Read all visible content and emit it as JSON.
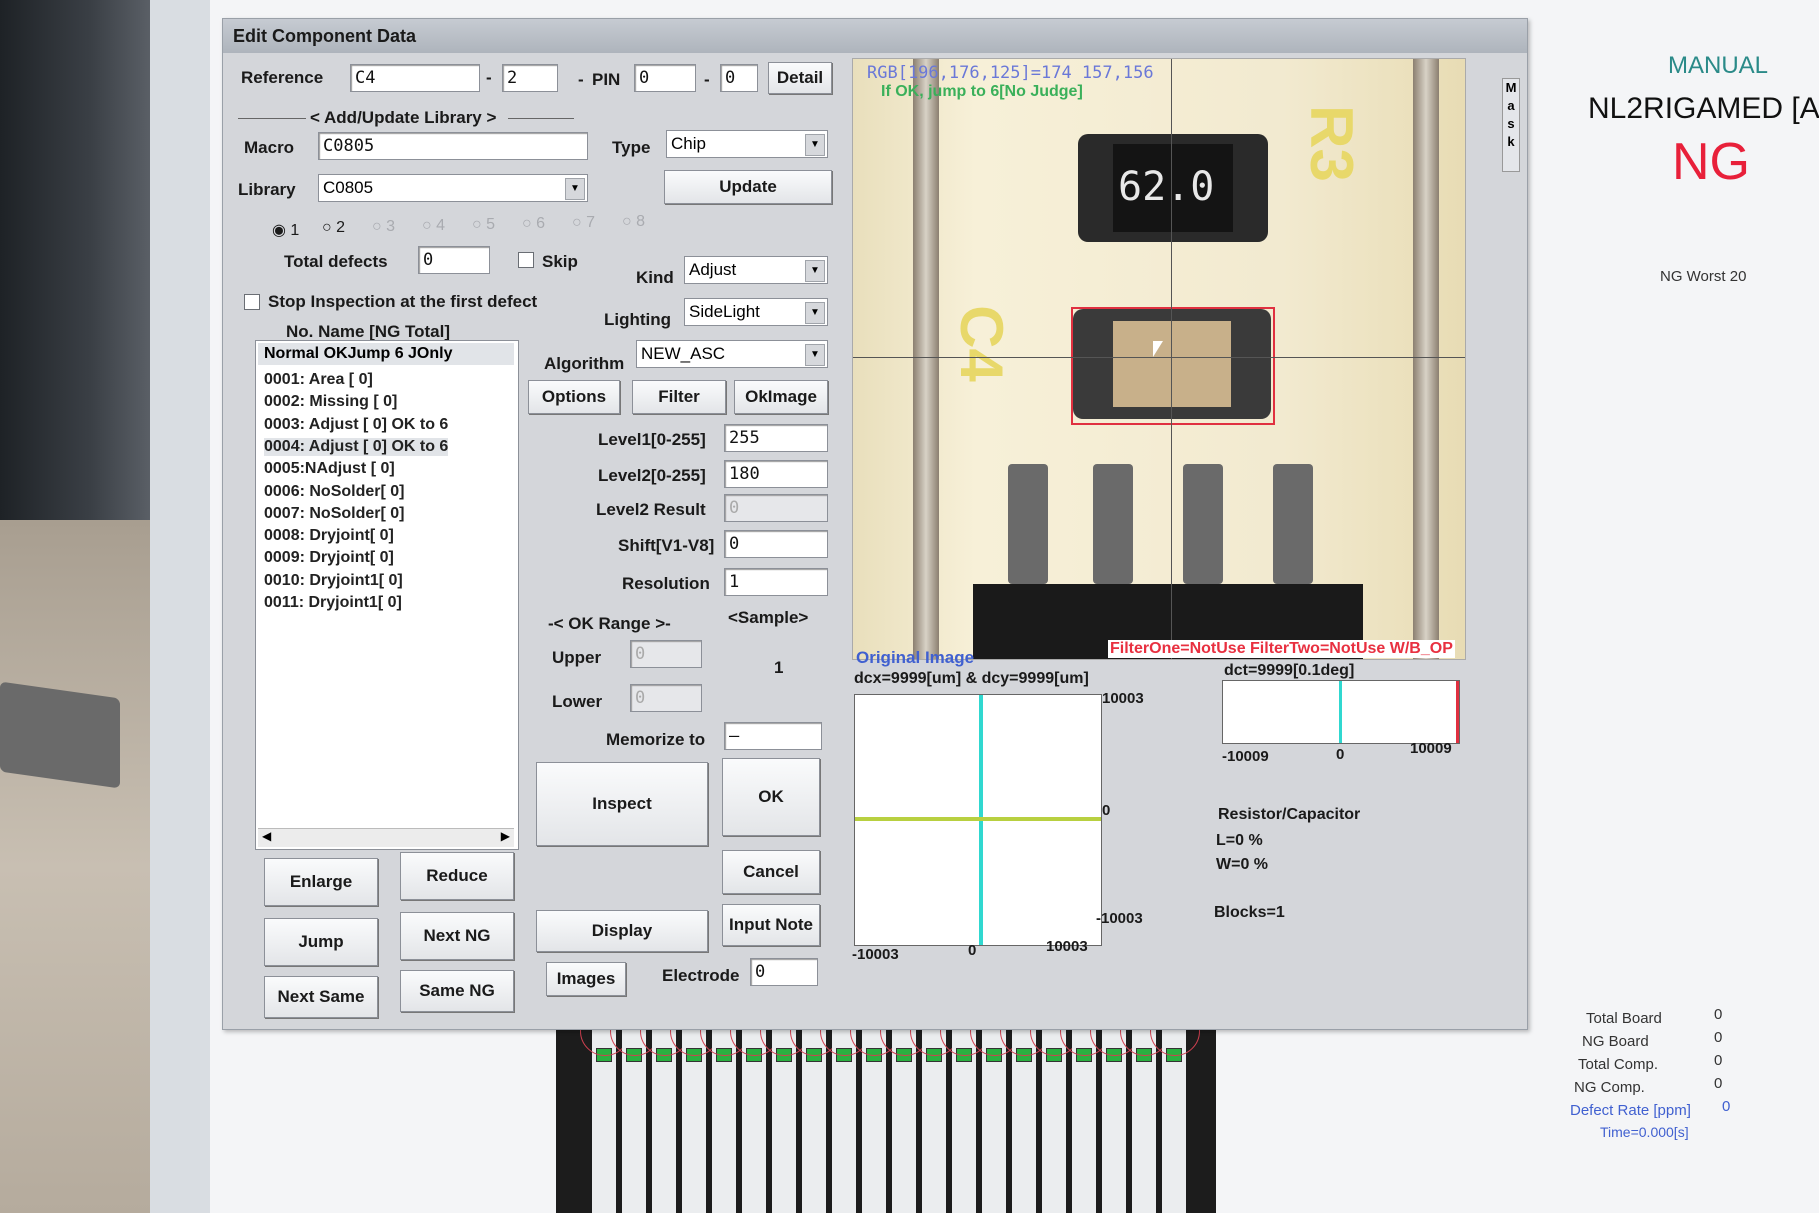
{
  "window": {
    "title": "Edit Component Data"
  },
  "reference": {
    "label": "Reference",
    "value": "C4",
    "sub": "2",
    "pin_label": "PIN",
    "pin_a": "0",
    "pin_b": "0",
    "sep1": "-",
    "sep2": "-",
    "sep3": "-",
    "detail_button": "Detail"
  },
  "library": {
    "section": "Add/Update Library",
    "macro_label": "Macro",
    "macro_value": "C0805",
    "library_label": "Library",
    "library_value": "C0805",
    "type_label": "Type",
    "type_value": "Chip",
    "update_button": "Update",
    "radios": [
      "1",
      "2",
      "3",
      "4",
      "5",
      "6",
      "7",
      "8"
    ],
    "selected_radio": "1"
  },
  "defects": {
    "total_label": "Total defects",
    "total_value": "0",
    "skip_label": "Skip",
    "stop_label": "Stop Inspection at the first defect"
  },
  "kind": {
    "label": "Kind",
    "value": "Adjust"
  },
  "lighting": {
    "label": "Lighting",
    "value": "SideLight"
  },
  "algorithm": {
    "label": "Algorithm",
    "value": "NEW_ASC"
  },
  "buttons": {
    "options": "Options",
    "filter": "Filter",
    "okimage": "OkImage",
    "inspect": "Inspect",
    "ok": "OK",
    "cancel": "Cancel",
    "display": "Display",
    "input_note": "Input Note",
    "images": "Images",
    "enlarge": "Enlarge",
    "reduce": "Reduce",
    "jump": "Jump",
    "next_ng": "Next NG",
    "next_same": "Next Same",
    "same_ng": "Same NG"
  },
  "params": {
    "level1_label": "Level1[0-255]",
    "level1_value": "255",
    "level2_label": "Level2[0-255]",
    "level2_value": "180",
    "level2_result_label": "Level2 Result",
    "level2_result_value": "0",
    "shift_label": "Shift[V1-V8]",
    "shift_value": "0",
    "resolution_label": "Resolution",
    "resolution_value": "1",
    "ok_range": "OK Range",
    "sample_label": "<Sample>",
    "sample_value": "1",
    "upper_label": "Upper",
    "upper_value": "0",
    "lower_label": "Lower",
    "lower_value": "0",
    "memorize_label": "Memorize to",
    "memorize_value": "—",
    "electrode_label": "Electrode",
    "electrode_value": "0"
  },
  "list": {
    "caption": "No. Name  [NG Total]",
    "header": "Normal OKJump 6 JOnly",
    "items": [
      "0001: Area   [    0]",
      "0002: Missing [    0]",
      "0003: Adjust  [    0] OK to 6",
      "0004: Adjust  [    0] OK to 6",
      "0005:NAdjust  [    0]",
      "0006: NoSolder[    0]",
      "0007: NoSolder[    0]",
      "0008: Dryjoint[    0]",
      "0009: Dryjoint[    0]",
      "0010: Dryjoint1[    0]",
      "0011: Dryjoint1[    0]"
    ],
    "selected_index": 3
  },
  "image": {
    "rgb": "RGB[196,176,125]=174  157,156",
    "ok_jump": "If OK, jump to 6[No Judge]",
    "component_mark": "62.0",
    "silk_r3": "R3",
    "silk_c4": "C4",
    "original_label": "Original Image",
    "filter_label": "FilterOne=NotUse FilterTwo=NotUse W/B_OP",
    "mask_label": "Mask"
  },
  "plot_xy": {
    "title": "dcx=9999[um] & dcy=9999[um]",
    "y_top": "10003",
    "y_mid": "0",
    "y_bot": "-10003",
    "x_left": "-10003",
    "x_mid": "0",
    "x_right": "10003"
  },
  "plot_t": {
    "title": "dct=9999[0.1deg]",
    "x_left": "-10009",
    "x_mid": "0",
    "x_right": "10009"
  },
  "info": {
    "type": "Resistor/Capacitor",
    "l": "L=0 %",
    "w": "W=0 %",
    "blocks": "Blocks=1"
  },
  "side": {
    "mode": "MANUAL",
    "program": "NL2RIGAMED [A",
    "result": "NG",
    "worst": "NG Worst 20",
    "stats": [
      {
        "label": "Total Board",
        "value": "0"
      },
      {
        "label": "NG Board",
        "value": "0"
      },
      {
        "label": "Total Comp.",
        "value": "0"
      },
      {
        "label": "NG Comp.",
        "value": "0"
      },
      {
        "label": "Defect Rate [ppm]",
        "value": "0"
      }
    ],
    "time": "Time=0.000[s]"
  },
  "colors": {
    "result_ng": "#e8203a",
    "mode": "#2a8a88",
    "accent_blue": "#4060d0",
    "green_trace": "#b8d040",
    "cyan_trace": "#30d8d0"
  }
}
